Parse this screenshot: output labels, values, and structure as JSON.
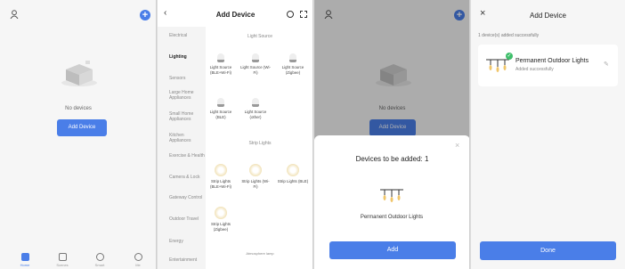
{
  "home": {
    "empty_text": "No devices",
    "add_button": "Add Device",
    "tabs": [
      {
        "label": "Home"
      },
      {
        "label": "Scenes"
      },
      {
        "label": "Smart"
      },
      {
        "label": "Me"
      }
    ]
  },
  "add": {
    "title": "Add Device",
    "categories": [
      "Electrical",
      "Lighting",
      "Sensors",
      "Large Home Appliances",
      "Small Home Appliances",
      "Kitchen Appliances",
      "Exercise & Health",
      "Camera & Lock",
      "Gateway Control",
      "Outdoor Travel",
      "Energy",
      "Entertainment"
    ],
    "section_light": "Light Source",
    "section_strip": "Strip Lights",
    "section_more": "Atmosphere lamp",
    "light_items": [
      "Light Source (BLE+Wi-Fi)",
      "Light Source (Wi-Fi)",
      "Light Source (Zigbee)",
      "Light Source (BLE)",
      "Light Source (other)"
    ],
    "strip_items": [
      "Strip Lights (BLE+Wi-Fi)",
      "Strip Lights (Wi-Fi)",
      "Strip Lights (BLE)",
      "Strip Lights (Zigbee)"
    ]
  },
  "sheet": {
    "title": "Devices to be added: 1",
    "device_name": "Permanent Outdoor Lights",
    "add_button": "Add",
    "bg_empty_text": "No devices",
    "bg_add_button": "Add Device"
  },
  "done": {
    "title": "Add Device",
    "success_count": "1 device(s) added successfully",
    "device_name": "Permanent Outdoor Lights",
    "device_status": "Added successfully",
    "done_button": "Done"
  }
}
